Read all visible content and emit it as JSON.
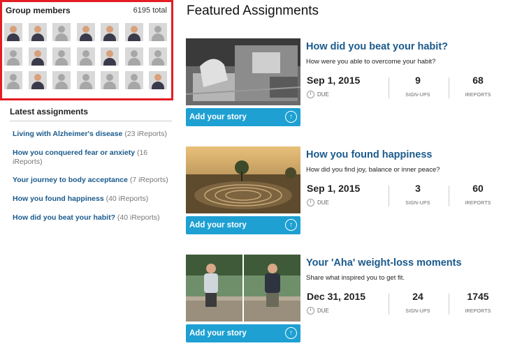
{
  "sidebar": {
    "members_title": "Group members",
    "members_total": "6195 total",
    "latest_title": "Latest assignments",
    "latest": [
      {
        "title": "Living with Alzheimer's disease",
        "count": "(23 iReports)"
      },
      {
        "title": "How you conquered fear or anxiety",
        "count": "(16 iReports)"
      },
      {
        "title": "Your journey to body acceptance",
        "count": "(7 iReports)"
      },
      {
        "title": "How you found happiness",
        "count": "(40 iReports)"
      },
      {
        "title": "How did you beat your habit?",
        "count": "(40 iReports)"
      }
    ]
  },
  "main": {
    "title": "Featured Assignments",
    "cards": [
      {
        "title": "How did you beat your habit?",
        "subtitle": "How were you able to overcome your habit?",
        "date": "Sep 1, 2015",
        "due": "DUE",
        "signups": "9",
        "signups_label": "SIGN-UPS",
        "ireports": "68",
        "ireports_label": "IREPORTS",
        "button": "Add your story"
      },
      {
        "title": "How you found happiness",
        "subtitle": "How did you find joy, balance or inner peace?",
        "date": "Sep 1, 2015",
        "due": "DUE",
        "signups": "3",
        "signups_label": "SIGN-UPS",
        "ireports": "60",
        "ireports_label": "IREPORTS",
        "button": "Add your story"
      },
      {
        "title": "Your 'Aha' weight-loss moments",
        "subtitle": "Share what inspired you to get fit.",
        "date": "Dec 31, 2015",
        "due": "DUE",
        "signups": "24",
        "signups_label": "SIGN-UPS",
        "ireports": "1745",
        "ireports_label": "IREPORTS",
        "button": "Add your story"
      }
    ]
  },
  "colors": {
    "accent": "#1ea0d2",
    "link": "#1a5a8c",
    "highlight_border": "#e21d23"
  }
}
